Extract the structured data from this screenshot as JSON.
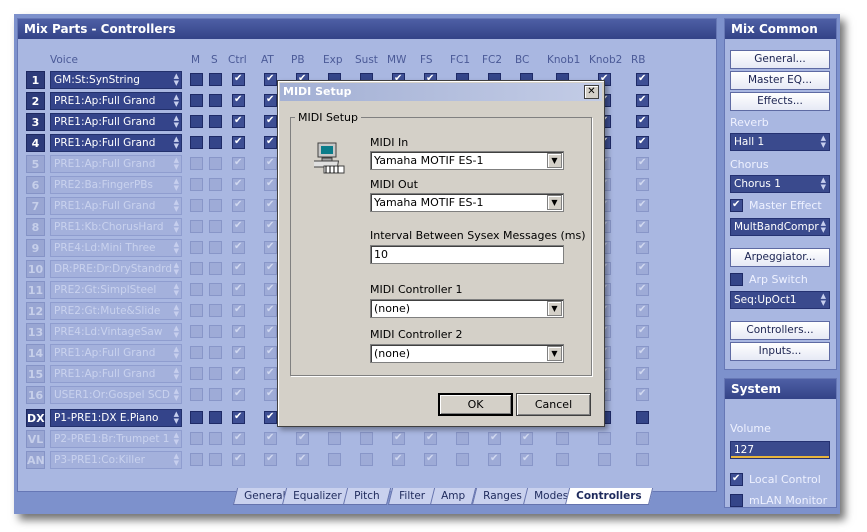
{
  "mix_parts": {
    "title": "Mix Parts - Controllers",
    "columns": [
      "Voice",
      "M",
      "S",
      "Ctrl",
      "AT",
      "PB",
      "Exp",
      "Sust",
      "MW",
      "FS",
      "FC1",
      "FC2",
      "BC",
      "Knob1",
      "Knob2",
      "RB"
    ],
    "parts": [
      {
        "num": "1",
        "voice": "GM:St:SynString",
        "active": true
      },
      {
        "num": "2",
        "voice": "PRE1:Ap:Full Grand",
        "active": true
      },
      {
        "num": "3",
        "voice": "PRE1:Ap:Full Grand",
        "active": true
      },
      {
        "num": "4",
        "voice": "PRE1:Ap:Full Grand",
        "active": true
      },
      {
        "num": "5",
        "voice": "PRE1:Ap:Full Grand",
        "active": false
      },
      {
        "num": "6",
        "voice": "PRE2:Ba:FingerPBs",
        "active": false
      },
      {
        "num": "7",
        "voice": "PRE1:Ap:Full Grand",
        "active": false
      },
      {
        "num": "8",
        "voice": "PRE1:Kb:ChorusHard",
        "active": false
      },
      {
        "num": "9",
        "voice": "PRE4:Ld:Mini Three",
        "active": false
      },
      {
        "num": "10",
        "voice": "DR:PRE:Dr:DryStandrd",
        "active": false
      },
      {
        "num": "11",
        "voice": "PRE2:Gt:SimplSteel",
        "active": false
      },
      {
        "num": "12",
        "voice": "PRE2:Gt:Mute&Slide",
        "active": false
      },
      {
        "num": "13",
        "voice": "PRE4:Ld:VintageSaw",
        "active": false
      },
      {
        "num": "14",
        "voice": "PRE1:Ap:Full Grand",
        "active": false
      },
      {
        "num": "15",
        "voice": "PRE1:Ap:Full Grand",
        "active": false
      },
      {
        "num": "16",
        "voice": "USER1:Or:Gospel SCD",
        "active": false
      }
    ],
    "extra_parts": [
      {
        "num": "DX",
        "voice": "P1-PRE1:DX E.Piano",
        "active": true
      },
      {
        "num": "VL",
        "voice": "P2-PRE1:Br:Trumpet 1",
        "active": false
      },
      {
        "num": "AN",
        "voice": "P3-PRE1:Co:Killer",
        "active": false
      }
    ]
  },
  "tabs": [
    "General",
    "Equalizer",
    "Pitch",
    "Filter",
    "Amp",
    "Ranges",
    "Modes",
    "Controllers"
  ],
  "active_tab": "Controllers",
  "mix_common": {
    "title": "Mix Common",
    "general_button": "General...",
    "master_eq_button": "Master EQ...",
    "effects_button": "Effects...",
    "reverb_label": "Reverb",
    "reverb_value": "Hall 1",
    "chorus_label": "Chorus",
    "chorus_value": "Chorus 1",
    "master_effect_label": "Master Effect",
    "master_effect_checked": true,
    "master_effect_value": "MultBandCompr",
    "arpeggiator_button": "Arpeggiator...",
    "arp_switch_label": "Arp Switch",
    "arp_switch_checked": false,
    "arp_type_value": "Seq:UpOct1",
    "controllers_button": "Controllers...",
    "inputs_button": "Inputs..."
  },
  "system": {
    "title": "System",
    "volume_label": "Volume",
    "volume_value": "127",
    "volume_fraction": 1.0,
    "local_control_label": "Local Control",
    "local_control_checked": true,
    "mlan_monitor_label": "mLAN Monitor",
    "mlan_monitor_checked": false
  },
  "dialog": {
    "title": "MIDI Setup",
    "close_glyph": "✕",
    "group_label": "MIDI Setup",
    "midi_in_label": "MIDI In",
    "midi_in_value": "Yamaha MOTIF ES-1",
    "midi_out_label": "MIDI Out",
    "midi_out_value": "Yamaha MOTIF ES-1",
    "interval_label": "Interval Between Sysex Messages (ms)",
    "interval_value": "10",
    "controller1_label": "MIDI Controller 1",
    "controller1_value": "(none)",
    "controller2_label": "MIDI Controller 2",
    "controller2_value": "(none)",
    "ok_button": "OK",
    "cancel_button": "Cancel"
  },
  "colors": {
    "panel_background": "#a9b7e1",
    "title_bar": "#334387",
    "accent_volume": "#e8b53c"
  }
}
